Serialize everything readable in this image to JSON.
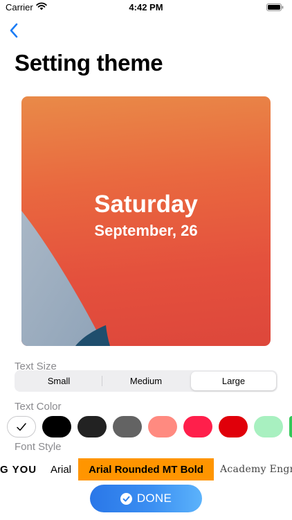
{
  "status_bar": {
    "carrier": "Carrier",
    "time": "4:42 PM",
    "icons": [
      "wifi-icon",
      "battery-icon"
    ]
  },
  "nav": {
    "back_icon": "chevron-left-icon",
    "title": "Setting theme"
  },
  "preview": {
    "day": "Saturday",
    "date": "September, 26"
  },
  "text_size": {
    "label": "Text Size",
    "options": [
      "Small",
      "Medium",
      "Large"
    ],
    "selected": "Large"
  },
  "text_color": {
    "label": "Text Color",
    "selected_icon": "checkmark-icon",
    "swatches": [
      "#ffffff",
      "#000000",
      "#222222",
      "#636363",
      "#ff8a80",
      "#ff1f4b",
      "#e0000a",
      "#a8f0c0",
      "#34c759"
    ]
  },
  "font_style": {
    "label": "Font Style",
    "options": [
      "G YOU",
      "Arial",
      "Arial Rounded MT Bold",
      "Academy Engra"
    ],
    "selected": "Arial Rounded MT Bold"
  },
  "done_button": {
    "label": "DONE",
    "icon": "check-circle-icon"
  },
  "colors": {
    "accent": "#2a77e8",
    "font_highlight": "#ff9500",
    "label_gray": "#8a8a8e"
  }
}
